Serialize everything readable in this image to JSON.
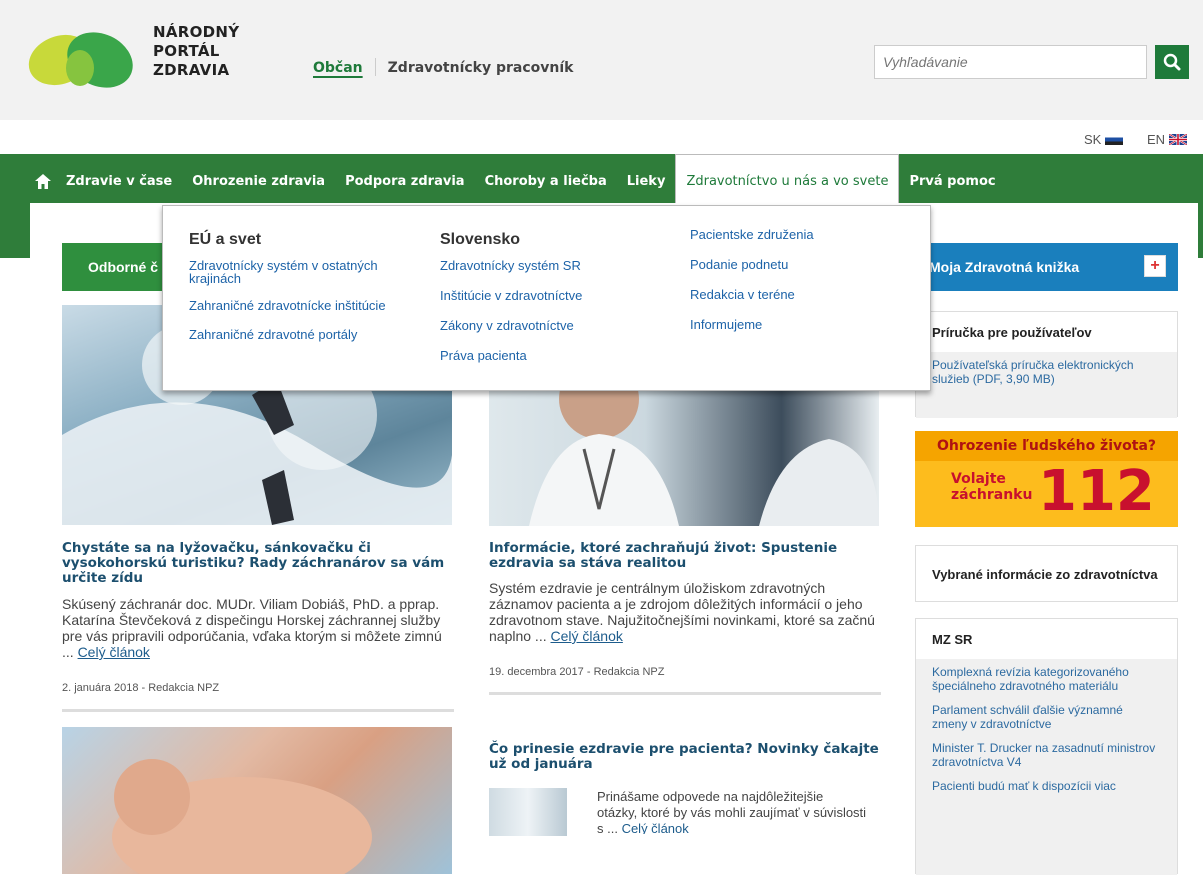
{
  "brand": {
    "name": "NÁRODNÝ PORTÁL ZDRAVIA",
    "line1": "NÁRODNÝ",
    "line2": "PORTÁL",
    "line3": "ZDRAVIA"
  },
  "audience": {
    "active": "Občan",
    "other": "Zdravotnícky pracovník"
  },
  "search": {
    "placeholder": "Vyhľadávanie",
    "icon": "search-icon"
  },
  "languages": [
    {
      "code": "SK",
      "flag": "slovak-flag-icon"
    },
    {
      "code": "EN",
      "flag": "uk-flag-icon"
    }
  ],
  "nav": {
    "home_icon": "home-icon",
    "items": [
      "Zdravie v čase",
      "Ohrozenie zdravia",
      "Podpora zdravia",
      "Choroby a liečba",
      "Lieky",
      "Zdravotníctvo u nás a vo svete",
      "Prvá pomoc"
    ],
    "active_index": 5
  },
  "dropdown": {
    "col1": {
      "title": "EÚ a svet",
      "links": [
        "Zdravotnícky systém v ostatných krajinách",
        "Zahraničné zdravotnícke inštitúcie",
        "Zahraničné zdravotné portály"
      ]
    },
    "col2": {
      "title": "Slovensko",
      "links": [
        "Zdravotnícky systém SR",
        "Inštitúcie v zdravotníctve",
        "Zákony v zdravotníctve",
        "Práva pacienta"
      ]
    },
    "col3": {
      "links": [
        "Pacientske združenia",
        "Podanie podnetu",
        "Redakcia v teréne",
        "Informujeme"
      ]
    }
  },
  "section_bar": {
    "label": "Odborné č"
  },
  "articles": [
    {
      "title": "Chystáte sa na lyžovačku, sánkovačku či vysokohorskú turistiku? Rady záchranárov sa vám určite zídu",
      "body": "Skúsený záchranár doc. MUDr. Viliam Dobiáš, PhD. a pprap. Katarína Števčeková z dispečingu Horskej záchrannej služby pre vás pripravili odporúčania, vďaka ktorým si môžete zimnú ... ",
      "more": "Celý článok",
      "meta": "2. januára 2018 - Redakcia NPZ"
    },
    {
      "title": "Informácie, ktoré zachraňujú život: Spustenie ezdravia sa stáva realitou",
      "body": "Systém ezdravie je centrálnym úložiskom zdravotných záznamov pacienta a je zdrojom dôležitých informácií o jeho zdravotnom stave. Najužitočnejšími novinkami, ktoré sa začnú naplno ... ",
      "more": "Celý článok",
      "meta": "19. decembra 2017 - Redakcia NPZ"
    },
    {
      "title": "Čo prinesie ezdravie pre pacienta? Novinky čakajte už od januára",
      "body": "Prinášame odpovede na najdôležitejšie otázky, ktoré by vás mohli zaujímať v súvislosti s ... ",
      "more": "Celý článok"
    }
  ],
  "sidebar": {
    "book": {
      "label": "Moja Zdravotná knižka",
      "plus": "+"
    },
    "guide": {
      "title": "Príručka pre používateľov",
      "links": [
        "Používateľská príručka elektronických služieb (PDF, 3,90 MB)"
      ]
    },
    "emergency": {
      "question": "Ohrozenie ľudského života?",
      "call1": "Volajte",
      "call2": "záchranku",
      "number": "112"
    },
    "selected": {
      "title": "Vybrané informácie zo zdravotníctva"
    },
    "mzsr": {
      "title": "MZ SR",
      "links": [
        "Komplexná revízia kategorizovaného špeciálneho zdravotného materiálu",
        "Parlament schválil ďalšie významné zmeny v zdravotníctve",
        "Minister T. Drucker na zasadnutí ministrov zdravotníctva V4",
        "Pacienti budú mať k dispozícii viac"
      ]
    }
  },
  "colors": {
    "nav_green": "#2f7d3a",
    "accent_green": "#1e7a3a",
    "blue": "#1a7fbd",
    "emergency_yellow": "#fdbc1d",
    "emergency_red": "#c8102e"
  }
}
